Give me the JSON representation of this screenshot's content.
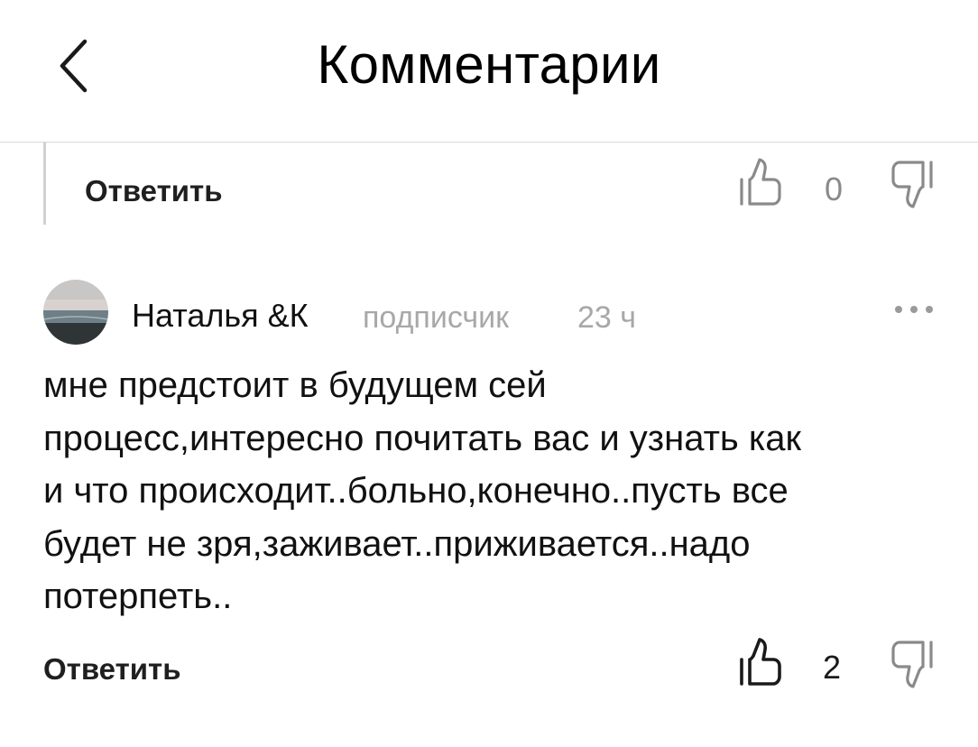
{
  "header": {
    "title": "Комментарии",
    "back_icon": "chevron-left-icon"
  },
  "previous_comment": {
    "reply_label": "Ответить",
    "likes": "0",
    "like_icon": "thumbs-up-icon",
    "dislike_icon": "thumbs-down-icon"
  },
  "comment": {
    "author": "Наталья &К",
    "role": "подписчик",
    "time": "23 ч",
    "more_icon": "more-dots-icon",
    "text": "мне предстоит в будущем сей\nпроцесс,интересно  почитать вас и узнать как\nи что происходит..больно,конечно..пусть все\nбудет не зря,заживает..приживается..надо\nпотерпеть..",
    "reply_label": "Ответить",
    "likes": "2",
    "like_icon": "thumbs-up-icon",
    "dislike_icon": "thumbs-down-icon"
  },
  "colors": {
    "muted_text": "#a8a8a8",
    "icon_light": "#8a8a8a",
    "icon_dark": "#1a1a1a",
    "divider": "#d9d9d9"
  }
}
